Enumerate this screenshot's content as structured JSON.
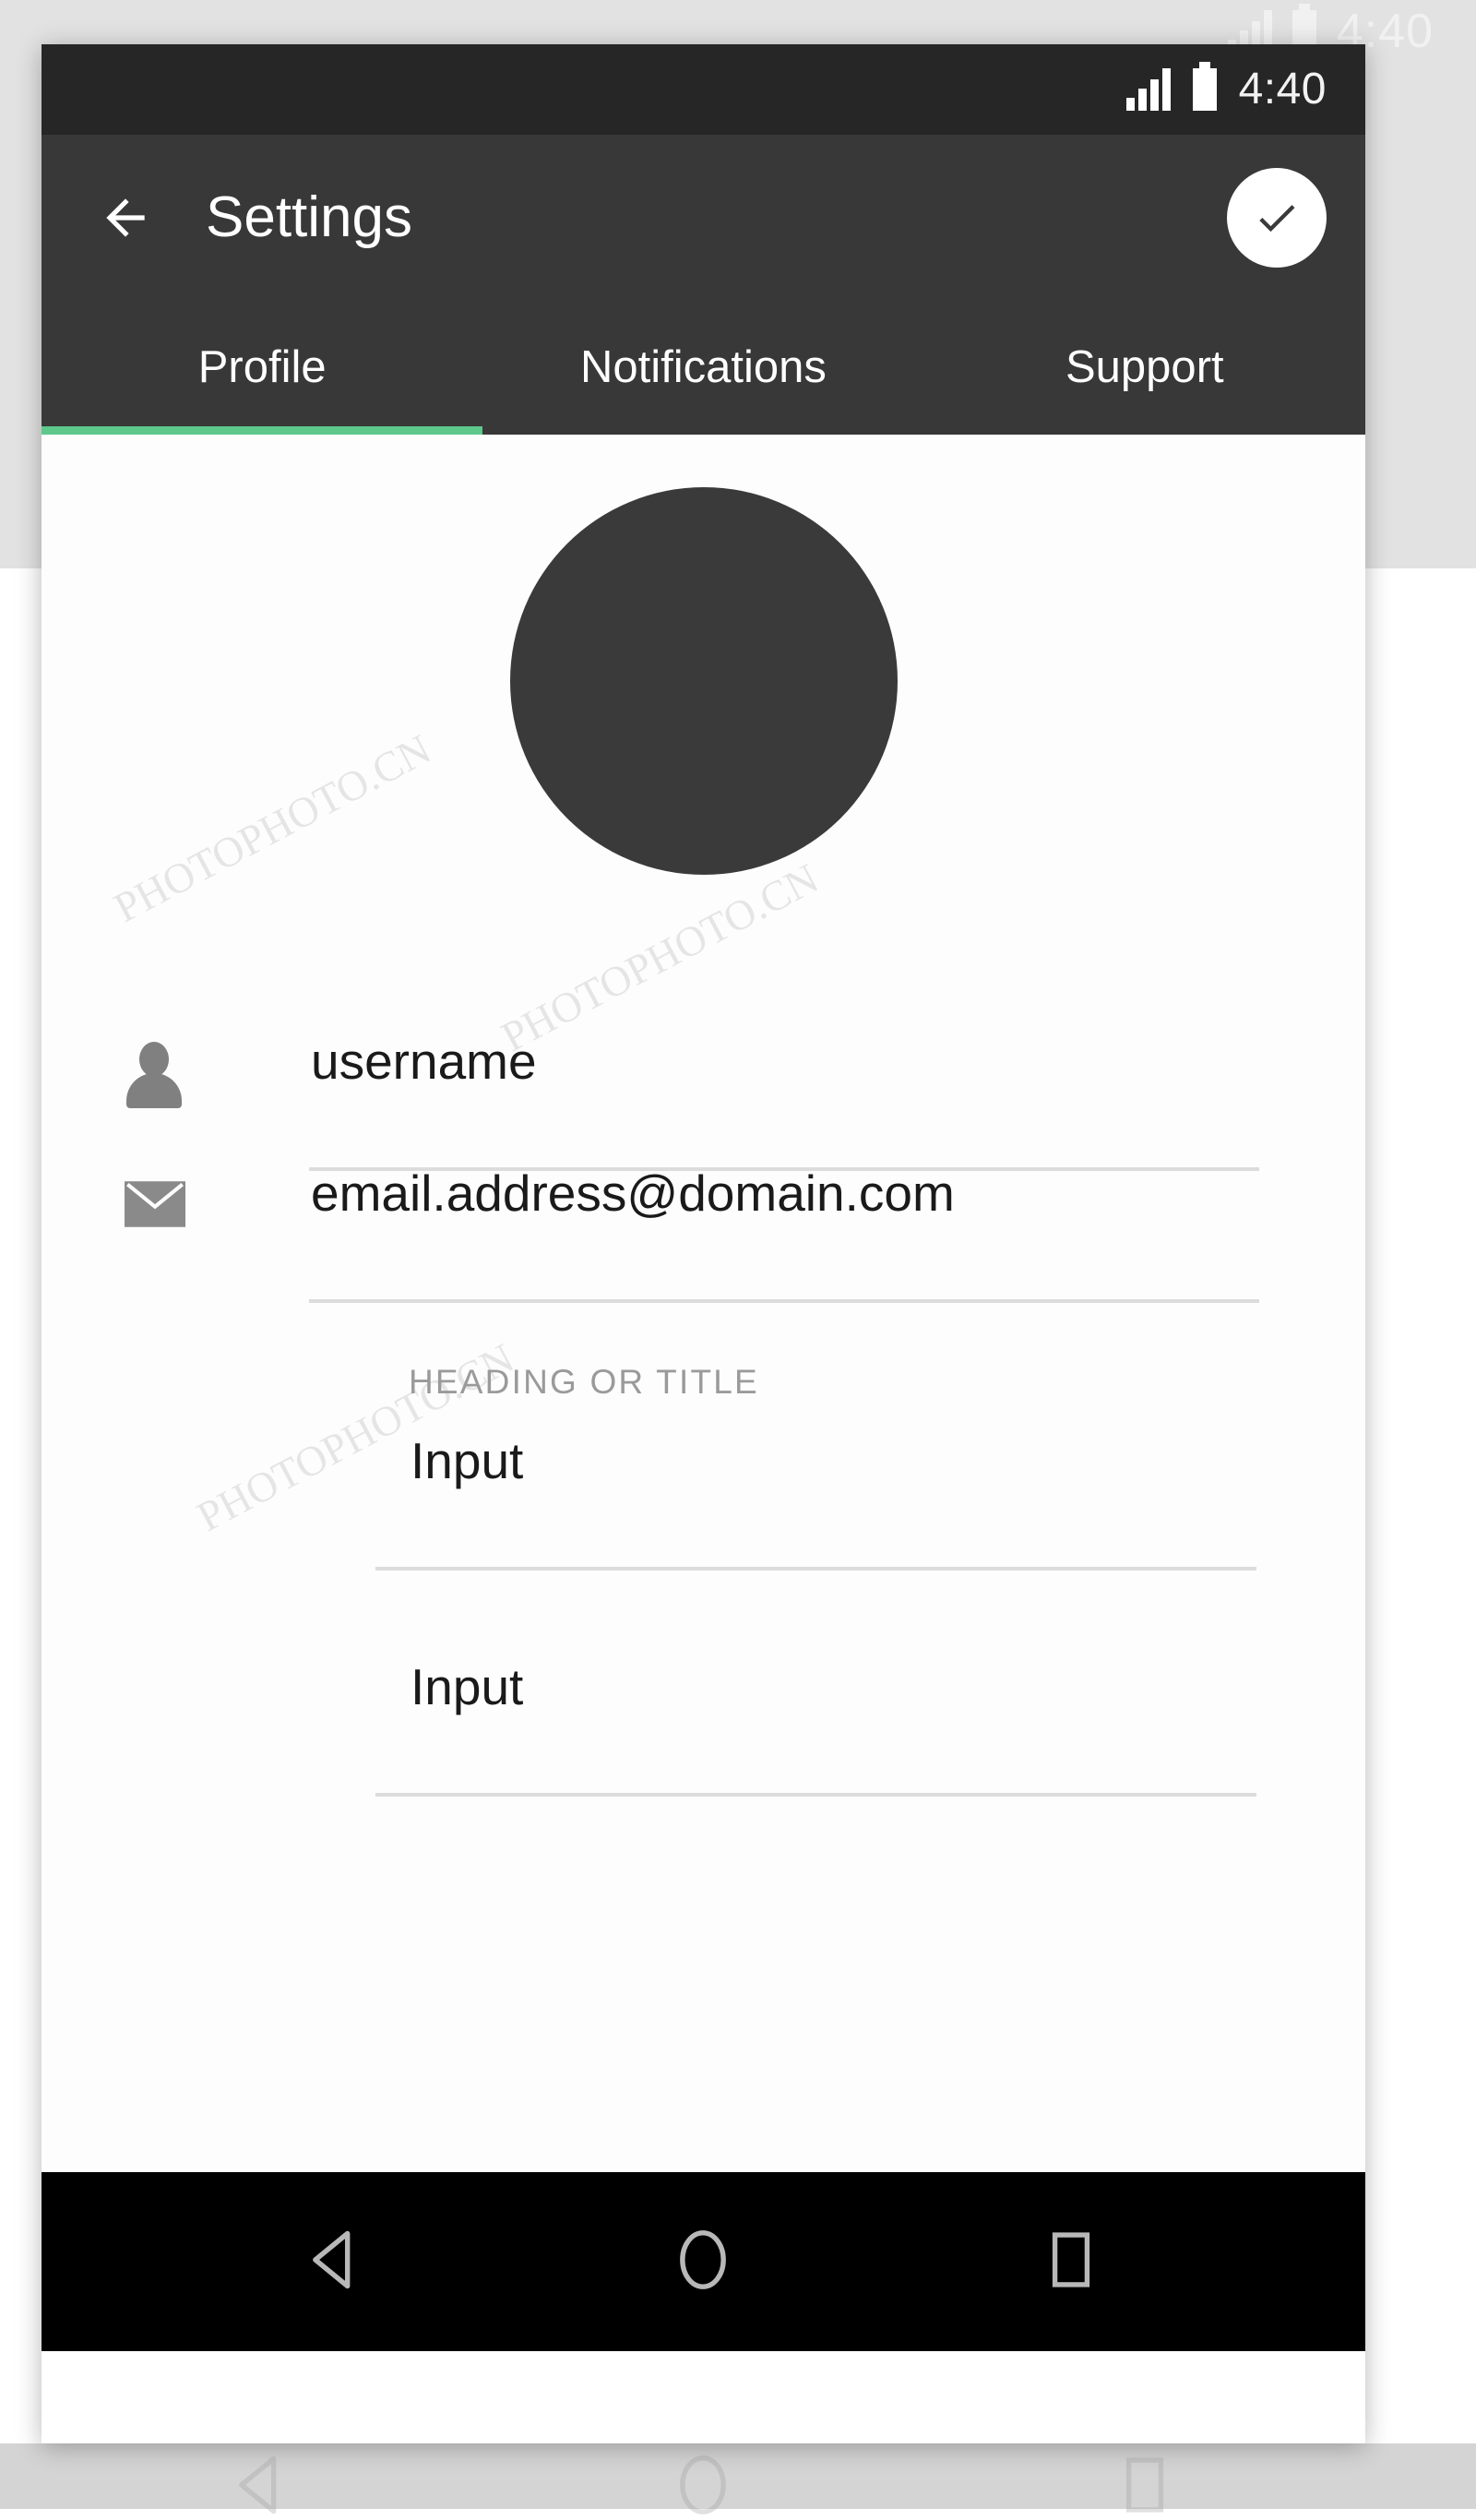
{
  "status_bar": {
    "time": "4:40",
    "signal_icon": "signal-bars-icon",
    "battery_icon": "battery-icon"
  },
  "app_bar": {
    "back_icon": "back-arrow-icon",
    "title": "Settings",
    "confirm_icon": "check-icon"
  },
  "tabs": {
    "items": [
      {
        "label": "Profile",
        "active": true
      },
      {
        "label": "Notifications",
        "active": false
      },
      {
        "label": "Support",
        "active": false
      }
    ],
    "indicator_color": "#5ec78c"
  },
  "profile": {
    "avatar_name": "profile-avatar-placeholder",
    "fields": [
      {
        "icon": "person-icon",
        "value": "username",
        "placeholder": "username"
      },
      {
        "icon": "mail-icon",
        "value": "email.address@domain.com",
        "placeholder": "email.address@domain.com"
      }
    ],
    "section_heading": "HEADING OR TITLE",
    "inputs": [
      {
        "value": "Input",
        "placeholder": "Input"
      },
      {
        "value": "Input",
        "placeholder": "Input"
      }
    ]
  },
  "nav_bar": {
    "back_icon": "triangle-back-icon",
    "home_icon": "circle-home-icon",
    "recents_icon": "square-recents-icon"
  },
  "theme": {
    "app_bar_bg": "#383838",
    "status_bar_bg": "#262626",
    "accent": "#5ec78c",
    "content_bg": "#fdfdfd",
    "avatar_bg": "#3a3a3a",
    "nav_bar_bg": "#000000",
    "page_bg_top": "#e2e2e2",
    "page_bg_bottom": "#d4d4d4"
  },
  "watermarks": {
    "text": "PHOTOPHOTO.CN"
  }
}
